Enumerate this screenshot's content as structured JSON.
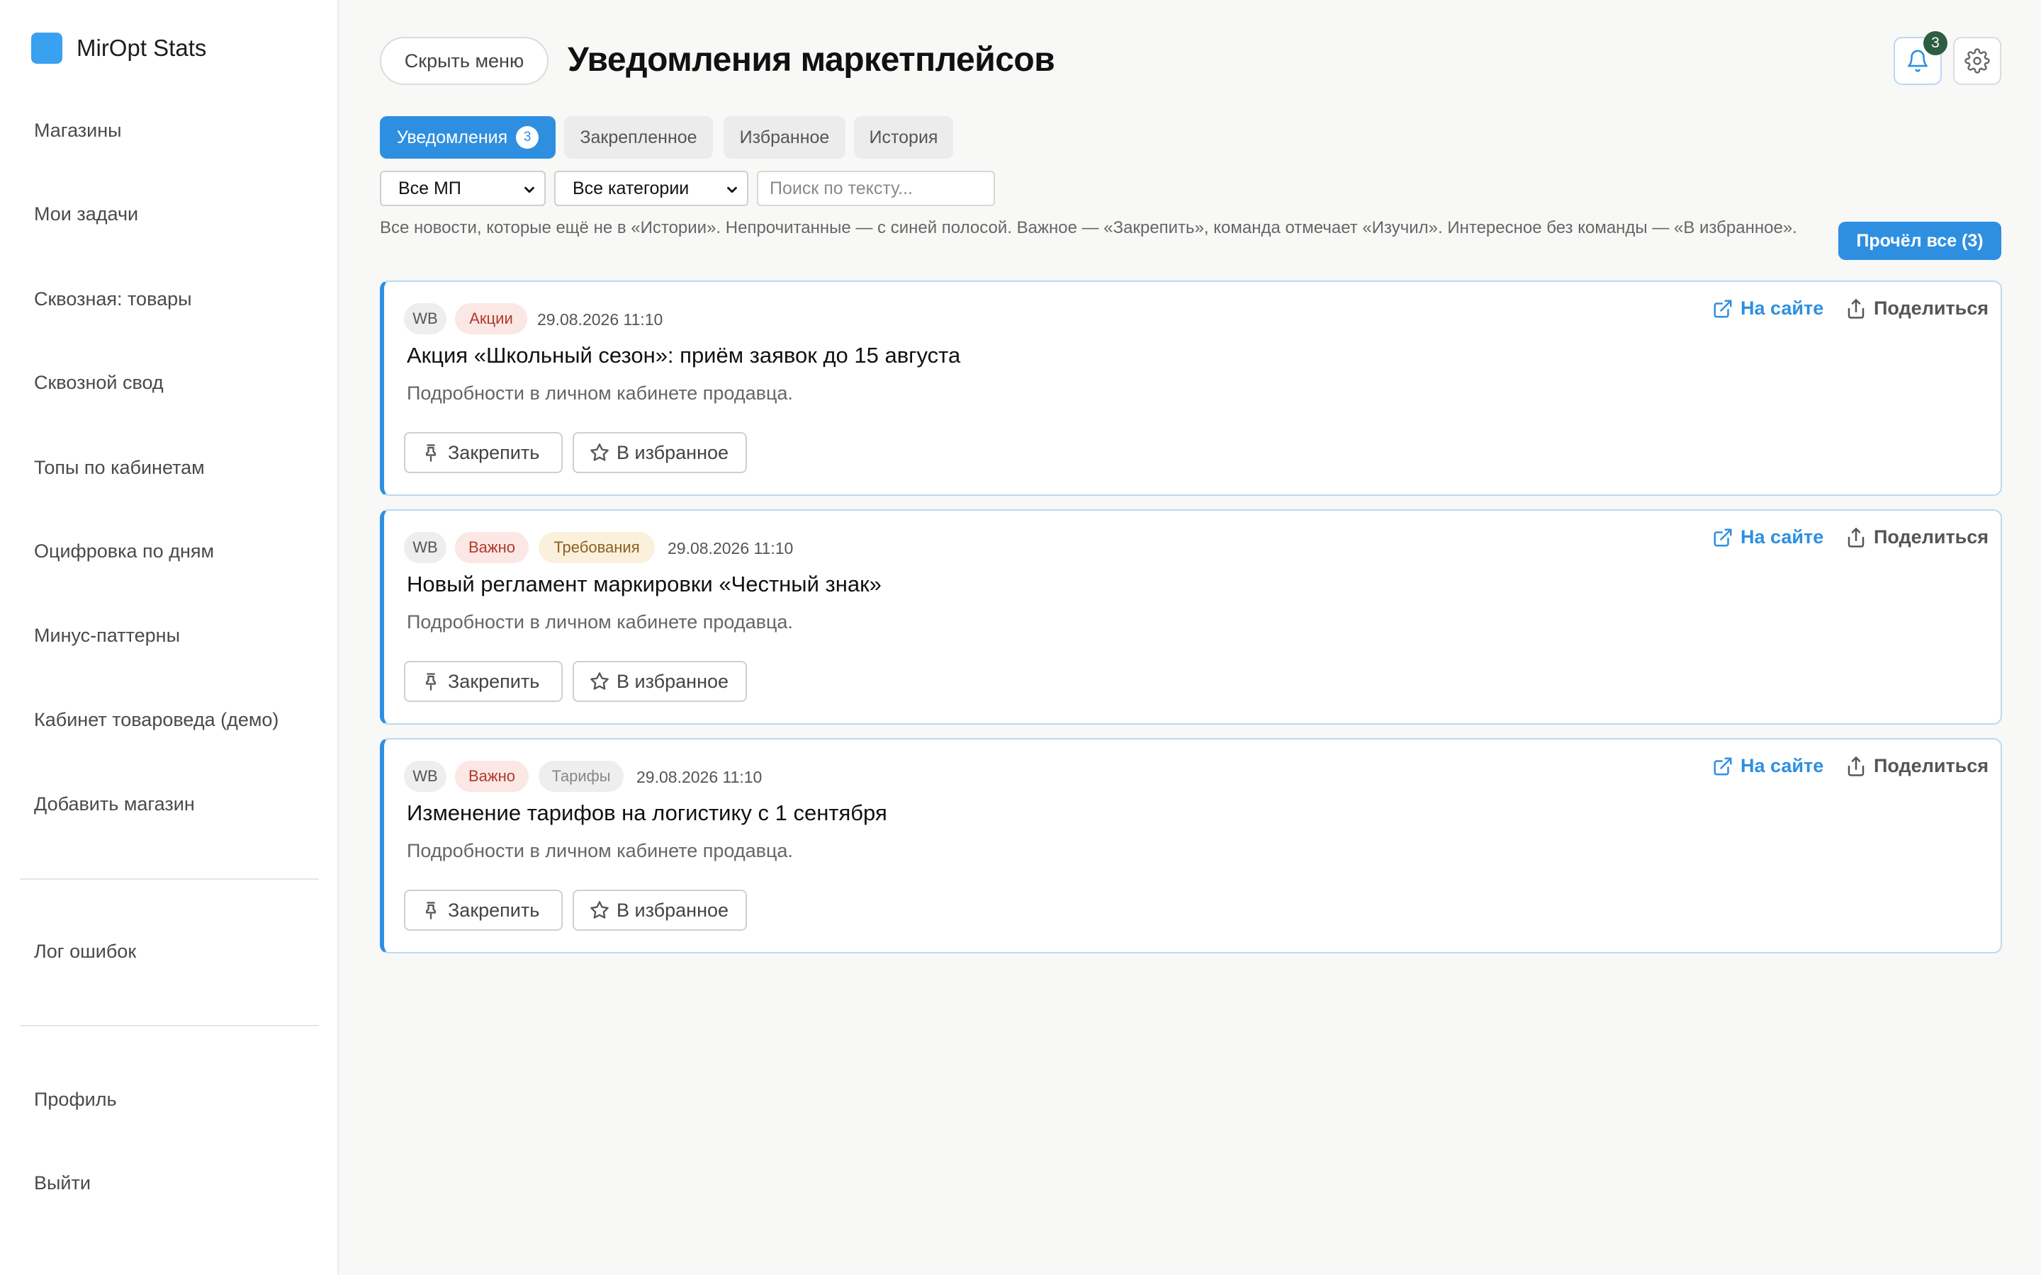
{
  "app": {
    "name": "MirOpt Stats",
    "accent": "#2e8fe0"
  },
  "sidebar": {
    "items": [
      {
        "label": "Магазины"
      },
      {
        "label": "Мои задачи"
      },
      {
        "label": "Сквозная: товары"
      },
      {
        "label": "Сквозной свод"
      },
      {
        "label": "Топы по кабинетам"
      },
      {
        "label": "Оцифровка по дням"
      },
      {
        "label": "Минус-паттерны"
      },
      {
        "label": "Кабинет товароведа (демо)"
      },
      {
        "label": "Добавить магазин"
      }
    ],
    "error_log": "Лог ошибок",
    "profile": "Профиль",
    "logout": "Выйти"
  },
  "header": {
    "hide_menu": "Скрыть меню",
    "title": "Уведомления маркетплейсов",
    "notifications_count": "3",
    "bell_icon": "bell-icon",
    "settings_icon": "gear-icon"
  },
  "tabs": [
    {
      "label": "Уведомления",
      "count": "3",
      "active": true
    },
    {
      "label": "Закрепленное"
    },
    {
      "label": "Избранное"
    },
    {
      "label": "История"
    }
  ],
  "filters": {
    "mp": {
      "value": "Все МП"
    },
    "category": {
      "value": "Все категории"
    },
    "search_placeholder": "Поиск по тексту..."
  },
  "help_text": "Все новости, которые ещё не в «Истории». Непрочитанные — с синей полосой. Важное — «Закрепить», команда отмечает «Изучил». Интересное без команды — «В избранное».",
  "read_all": "Прочёл все (3)",
  "card_actions": {
    "pin": "Закрепить",
    "favorite": "В избранное",
    "on_site": "На сайте",
    "share": "Поделиться"
  },
  "notifications": [
    {
      "mp": "WB",
      "tags": [
        "Акции"
      ],
      "date": "29.08.2026 11:10",
      "title": "Акция «Школьный сезон»: приём заявок до 15 августа",
      "desc": "Подробности в личном кабинете продавца."
    },
    {
      "mp": "WB",
      "tags": [
        "Важно",
        "Требования"
      ],
      "date": "29.08.2026 11:10",
      "title": "Новый регламент маркировки «Честный знак»",
      "desc": "Подробности в личном кабинете продавца."
    },
    {
      "mp": "WB",
      "tags": [
        "Важно",
        "Тарифы"
      ],
      "date": "29.08.2026 11:10",
      "title": "Изменение тарифов на логистику с 1 сентября",
      "desc": "Подробности в личном кабинете продавца."
    }
  ]
}
